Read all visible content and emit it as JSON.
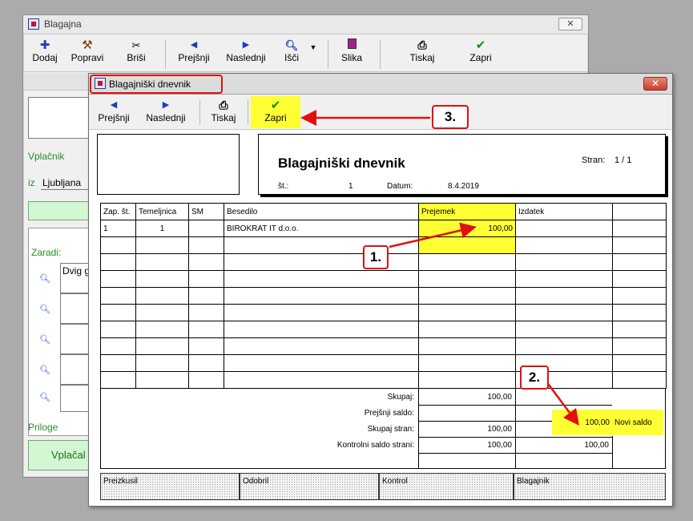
{
  "back_window": {
    "title": "Blagajna",
    "toolbar": [
      {
        "id": "dodaj",
        "label": "Dodaj",
        "icon": "plus-icon"
      },
      {
        "id": "popravi",
        "label": "Popravi",
        "icon": "hammer-icon"
      },
      {
        "id": "brisi",
        "label": "Briši",
        "icon": "scissors-icon"
      },
      {
        "id": "prejsnji",
        "label": "Prejšnji",
        "icon": "arrow-left-icon"
      },
      {
        "id": "naslednji",
        "label": "Naslednji",
        "icon": "arrow-right-icon"
      },
      {
        "id": "isci",
        "label": "Išči",
        "icon": "magnifier-icon"
      },
      {
        "id": "slika",
        "label": "Slika",
        "icon": "image-icon"
      },
      {
        "id": "tiskaj",
        "label": "Tiskaj",
        "icon": "printer-icon"
      },
      {
        "id": "zapri",
        "label": "Zapri",
        "icon": "checkmark-icon"
      }
    ],
    "vplacnik_label": "Vplačnik",
    "iz_label": "iz",
    "iz_value": "Ljubljana",
    "zaradi_label": "Zaradi:",
    "zaradi_first_value": "Dvig g",
    "priloge_label": "Priloge",
    "vplacal_label": "Vplačal"
  },
  "front_window": {
    "title": "Blagajniški dnevnik",
    "toolbar": [
      {
        "id": "prejsnji",
        "label": "Prejšnji",
        "icon": "arrow-left-icon"
      },
      {
        "id": "naslednji",
        "label": "Naslednji",
        "icon": "arrow-right-icon"
      },
      {
        "id": "tiskaj",
        "label": "Tiskaj",
        "icon": "printer-icon"
      },
      {
        "id": "zapri",
        "label": "Zapri",
        "icon": "checkmark-icon"
      }
    ],
    "report": {
      "heading": "Blagajniški dnevnik",
      "stran_label": "Stran:",
      "stran_value": "1 / 1",
      "st_label": "št.:",
      "st_value": "1",
      "datum_label": "Datum:",
      "datum_value": "8.4.2019"
    },
    "table": {
      "headers": [
        "Zap. št.",
        "Temeljnica",
        "SM",
        "Besedilo",
        "Prejemek",
        "Izdatek",
        ""
      ],
      "rows": [
        [
          "1",
          "1",
          "",
          "BIROKRAT IT d.o.o.",
          "100,00",
          "",
          ""
        ]
      ]
    },
    "totals": {
      "skupaj_label": "Skupaj:",
      "skupaj_prejemek": "100,00",
      "prejsnji_saldo_label": "Prejšnji saldo:",
      "novi_saldo_value": "100,00",
      "novi_saldo_label": "Novi saldo",
      "skupaj_stran_label": "Skupaj stran:",
      "skupaj_stran_prejemek": "100,00",
      "kontrolni_label": "Kontrolni saldo strani:",
      "kontrolni_prejemek": "100,00",
      "kontrolni_izdatek": "100,00"
    },
    "signatures": [
      "Preizkusil",
      "Odobril",
      "Kontrol",
      "Blagajnik"
    ]
  },
  "annotations": {
    "callout_1": "1.",
    "callout_2": "2.",
    "callout_3": "3.",
    "highlight_color": "#ffff33",
    "annotation_color": "#e01010"
  }
}
